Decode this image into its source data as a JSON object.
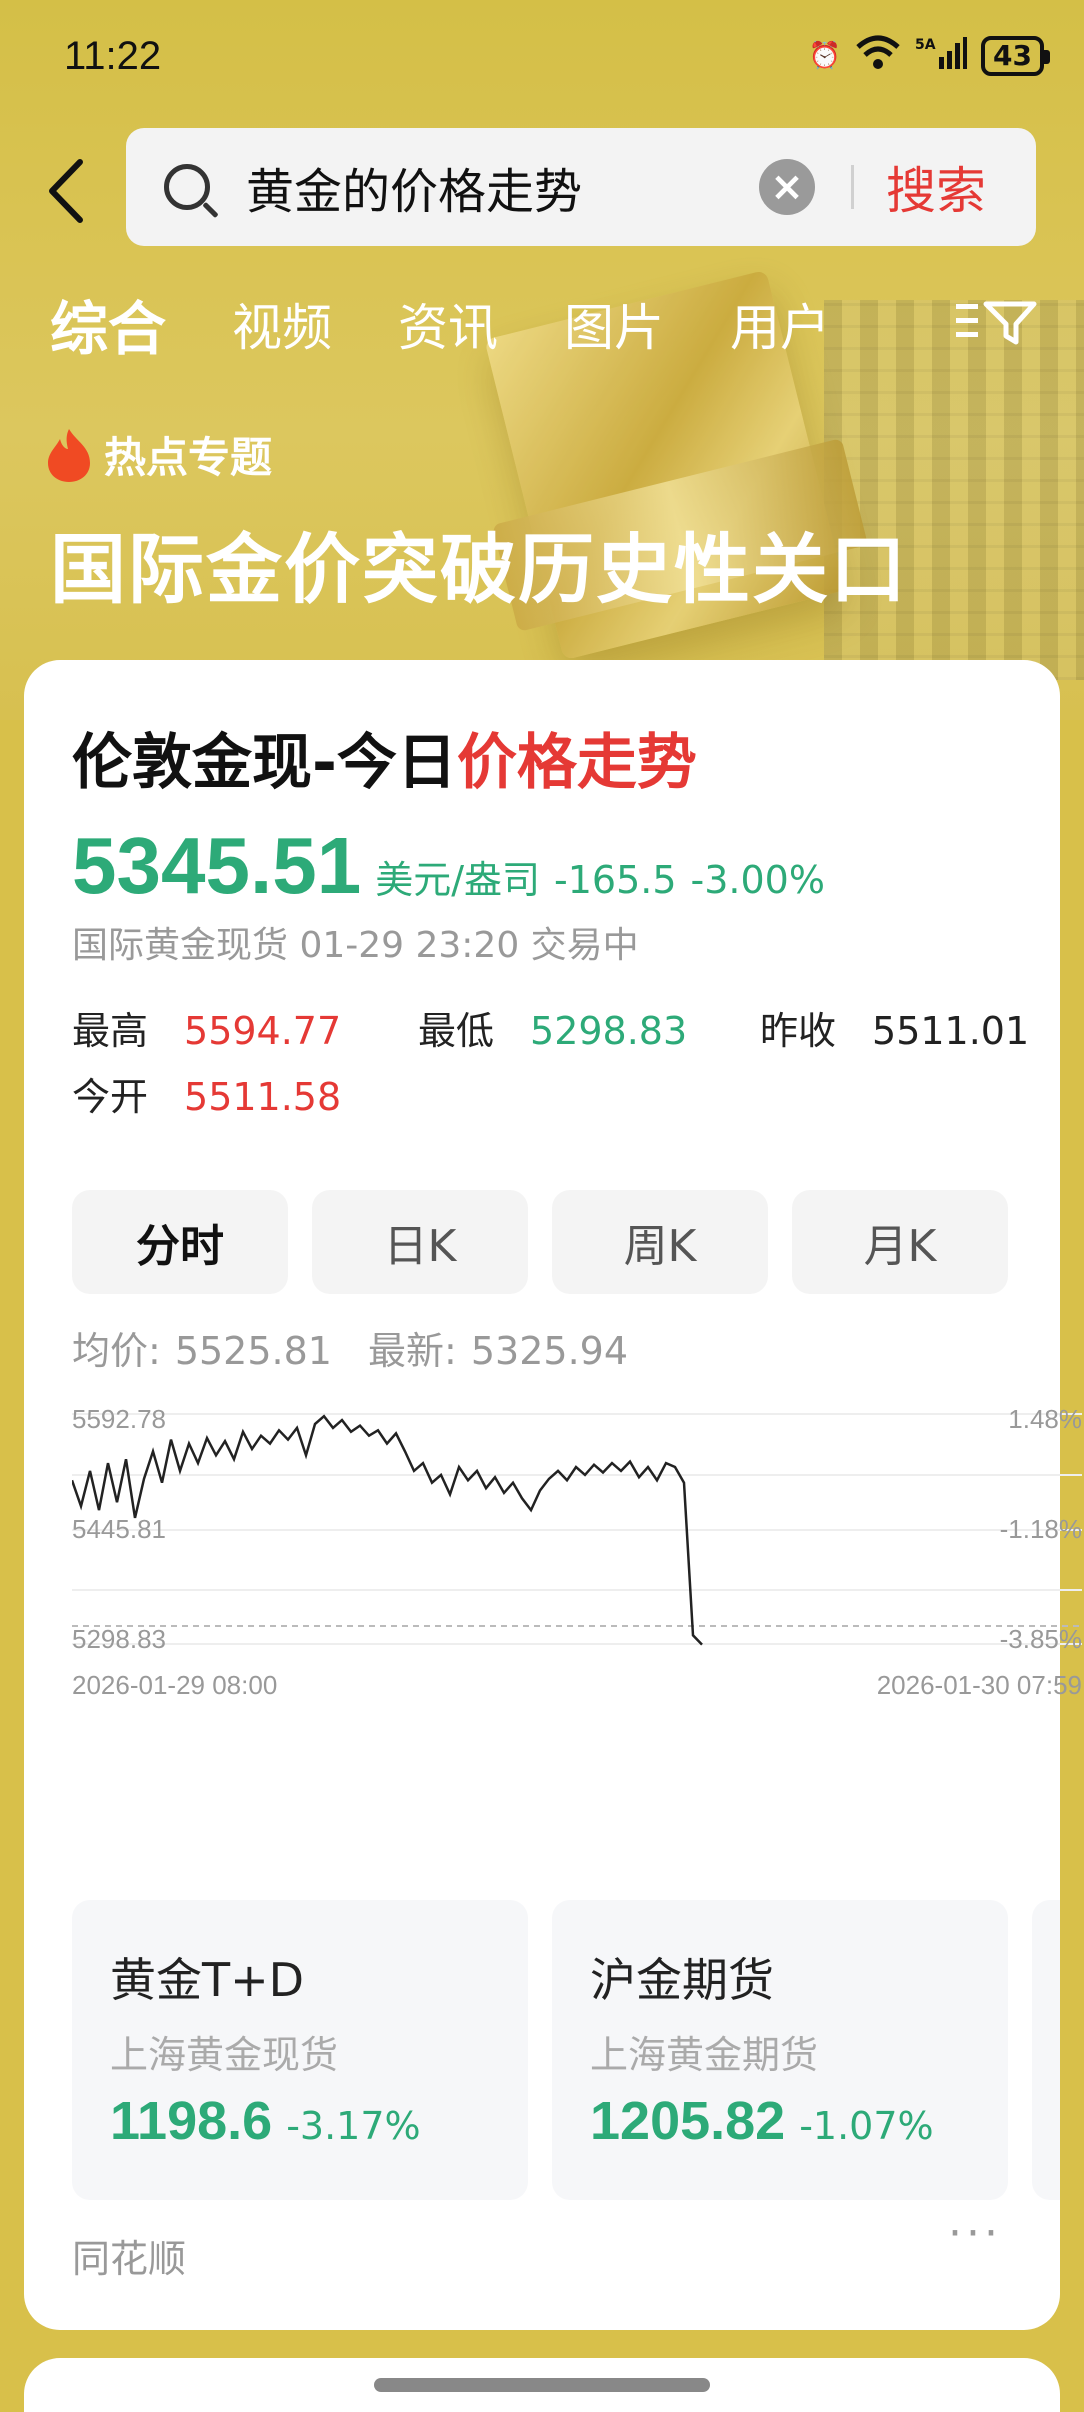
{
  "status_bar": {
    "time": "11:22",
    "network": "5A",
    "wifi": "6",
    "battery": "43"
  },
  "search": {
    "query": "黄金的价格走势",
    "button_label": "搜索"
  },
  "tabs": [
    {
      "label": "综合",
      "active": true
    },
    {
      "label": "视频"
    },
    {
      "label": "资讯"
    },
    {
      "label": "图片"
    },
    {
      "label": "用户"
    }
  ],
  "hot_topic": {
    "label": "热点专题",
    "headline": "国际金价突破历史性关口"
  },
  "card": {
    "title_black": "伦敦金现-今日",
    "title_red": "价格走势",
    "price": "5345.51",
    "unit": "美元/盎司",
    "change": "-165.5",
    "change_pct": "-3.00%",
    "sub_info": "国际黄金现货 01-29 23:20 交易中",
    "stats": {
      "high_label": "最高",
      "high": "5594.77",
      "low_label": "最低",
      "low": "5298.83",
      "prev_close_label": "昨收",
      "prev_close": "5511.01",
      "open_label": "今开",
      "open": "5511.58"
    },
    "period_tabs": [
      "分时",
      "日K",
      "周K",
      "月K"
    ],
    "avg_label": "均价:",
    "avg_value": "5525.81",
    "latest_label": "最新:",
    "latest_value": "5325.94"
  },
  "chart_data": {
    "type": "line",
    "y_left_ticks": [
      "5592.78",
      "5445.81",
      "5298.83"
    ],
    "y_right_ticks": [
      "1.48%",
      "-1.18%",
      "-3.85%"
    ],
    "ylim": [
      5298.83,
      5592.78
    ],
    "x_start": "2026-01-29 08:00",
    "x_end": "2026-01-30 07:59",
    "series": [
      {
        "values": [
          5508,
          5475,
          5520,
          5470,
          5530,
          5480,
          5535,
          5460,
          5510,
          5545,
          5505,
          5560,
          5520,
          5555,
          5530,
          5562,
          5540,
          5558,
          5535,
          5570,
          5548,
          5565,
          5555,
          5572,
          5560,
          5575,
          5540,
          5580,
          5590,
          5575,
          5585,
          5570,
          5578,
          5565,
          5572,
          5555,
          5568,
          5545,
          5520,
          5530,
          5505,
          5515,
          5490,
          5525,
          5508,
          5520,
          5498,
          5512,
          5492,
          5505,
          5485,
          5470,
          5495,
          5510,
          5520,
          5508,
          5525,
          5515,
          5528,
          5518,
          5530,
          5520,
          5532,
          5512,
          5525,
          5508,
          5530,
          5525,
          5505,
          5310,
          5298
        ]
      }
    ]
  },
  "markets": [
    {
      "name": "黄金T+D",
      "sub": "上海黄金现货",
      "price": "1198.6",
      "change": "-3.17%"
    },
    {
      "name": "沪金期货",
      "sub": "上海黄金期货",
      "price": "1205.82",
      "change": "-1.07%"
    }
  ],
  "source": "同花顺",
  "more": "···",
  "colors": {
    "up": "#e53935",
    "down": "#2daa78",
    "background": "#d8c04a"
  }
}
